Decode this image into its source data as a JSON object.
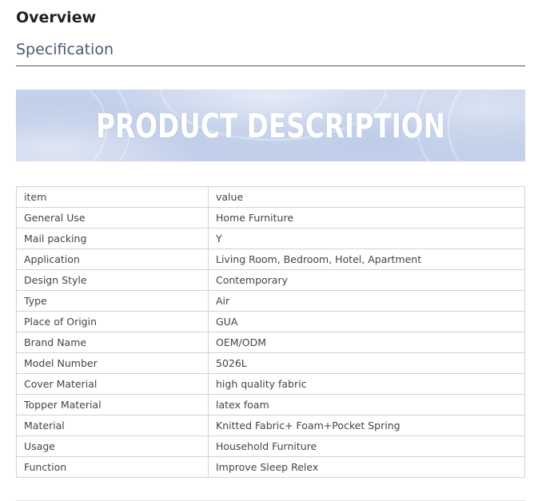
{
  "overview": {
    "title": "Overview"
  },
  "specification": {
    "title": "Specification"
  },
  "banner": {
    "text": "PRODUCT DESCRIPTION"
  },
  "table": {
    "header": {
      "item": "item",
      "value": "value"
    },
    "rows": [
      {
        "item": "General Use",
        "value": "Home Furniture"
      },
      {
        "item": "Mail packing",
        "value": "Y"
      },
      {
        "item": "Application",
        "value": "Living Room, Bedroom, Hotel, Apartment"
      },
      {
        "item": "Design Style",
        "value": "Contemporary"
      },
      {
        "item": "Type",
        "value": "Air"
      },
      {
        "item": "Place of Origin",
        "value": "GUA"
      },
      {
        "item": "Brand Name",
        "value": "OEM/ODM"
      },
      {
        "item": "Model Number",
        "value": "5026L"
      },
      {
        "item": "Cover Material",
        "value": "high quality fabric"
      },
      {
        "item": "Topper Material",
        "value": "latex foam"
      },
      {
        "item": "Material",
        "value": "Knitted Fabric+ Foam+Pocket Spring"
      },
      {
        "item": "Usage",
        "value": "Household Furniture"
      },
      {
        "item": "Function",
        "value": "Improve Sleep Relex"
      }
    ]
  },
  "colors": {
    "heading": "#222222",
    "subheading": "#4a5a70",
    "banner_bg": "#c0cdea",
    "table_border": "#d2d2d2",
    "table_text": "#444444"
  }
}
